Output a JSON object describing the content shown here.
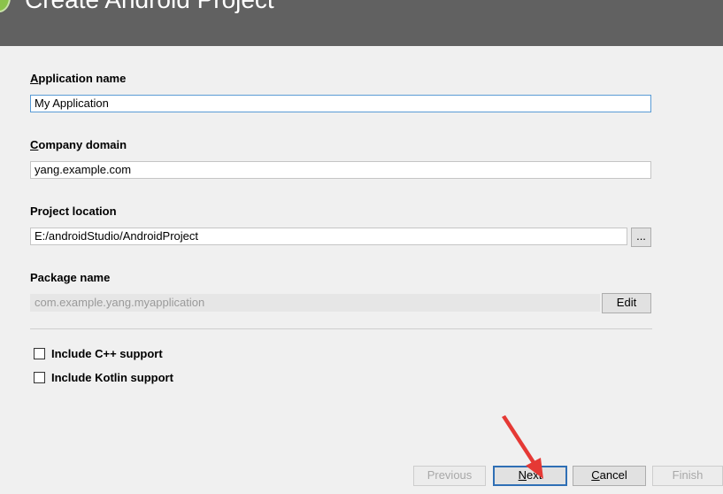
{
  "header": {
    "title": "Create Android Project"
  },
  "form": {
    "application_name": {
      "label": "Application name",
      "value": "My Application"
    },
    "company_domain": {
      "label": "Company domain",
      "value": "yang.example.com"
    },
    "project_location": {
      "label": "Project location",
      "value": "E:/androidStudio/AndroidProject",
      "browse_label": "..."
    },
    "package_name": {
      "label": "Package name",
      "value": "com.example.yang.myapplication",
      "edit_label": "Edit"
    },
    "options": [
      {
        "label": "Include C++ support",
        "checked": false
      },
      {
        "label": "Include Kotlin support",
        "checked": false
      }
    ]
  },
  "footer": {
    "previous_label": "Previous",
    "next_label": "Next",
    "cancel_label": "Cancel",
    "finish_label": "Finish"
  },
  "colors": {
    "header_bg": "#616161",
    "focus_border": "#5a9bd5",
    "annotation_arrow": "#e53935"
  }
}
